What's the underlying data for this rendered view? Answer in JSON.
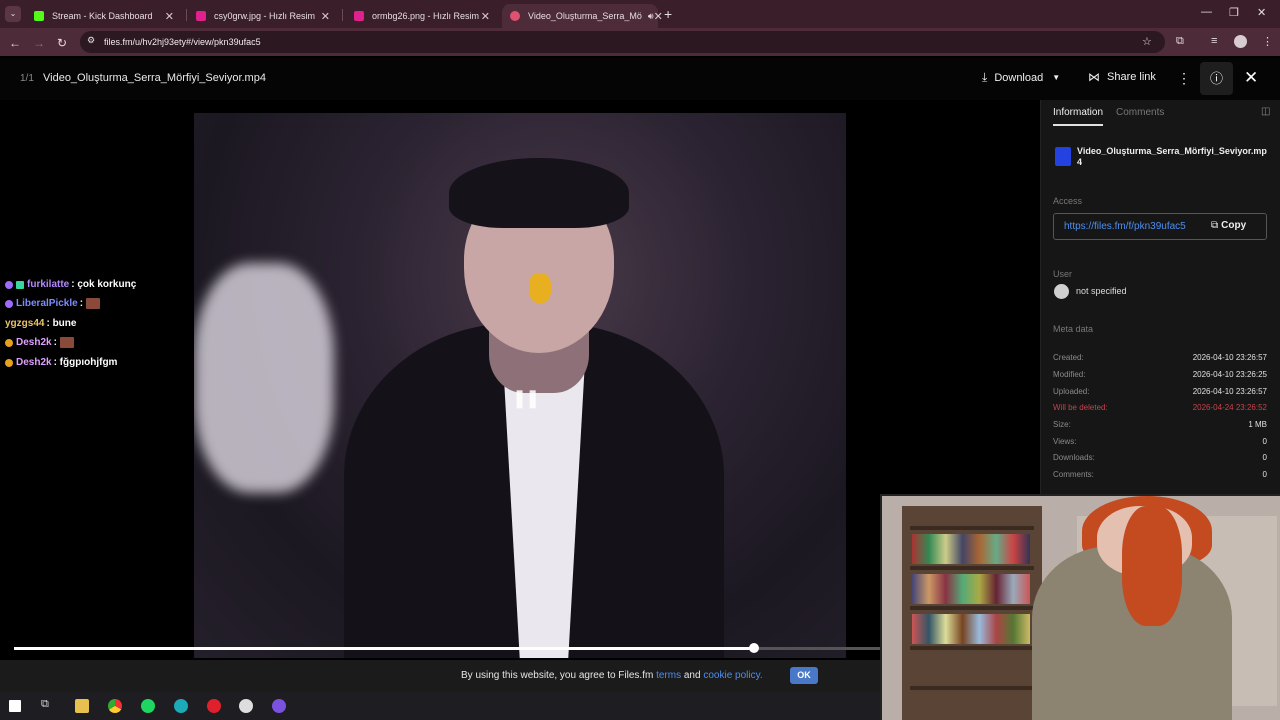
{
  "browser": {
    "tabs": [
      {
        "title": "Stream - Kick Dashboard",
        "favicon_color": "#53fc18"
      },
      {
        "title": "csy0grw.jpg - Hızlı Resim",
        "favicon_color": "#e0208c"
      },
      {
        "title": "ormbg26.png - Hızlı Resim",
        "favicon_color": "#e0208c"
      },
      {
        "title": "Video_Oluşturma_Serra_Mö",
        "favicon_color": "#e05070"
      }
    ],
    "url": "files.fm/u/hv2hj93ety#/view/pkn39ufac5"
  },
  "viewer": {
    "page_count": "1/1",
    "filename": "Video_Oluşturma_Serra_Mörfiyi_Seviyor.mp4",
    "download_label": "Download",
    "share_label": "Share link"
  },
  "chat": [
    {
      "user": "furkilatte",
      "user_color": "#b388ff",
      "message": ": çok korkunç",
      "emote": false
    },
    {
      "user": "LiberalPickle",
      "user_color": "#7c8cff",
      "message": ":",
      "emote": true
    },
    {
      "user": "ygzgs44",
      "user_color": "#e8c36a",
      "message": ": bune",
      "emote": false
    },
    {
      "user": "Desh2k",
      "user_color": "#e0a0ff",
      "message": ":",
      "emote": true
    },
    {
      "user": "Desh2k",
      "user_color": "#e0a0ff",
      "message": ": fğgpıohjfgm",
      "emote": false
    }
  ],
  "panel": {
    "tab_information": "Information",
    "tab_comments": "Comments",
    "filename": "Video_Oluşturma_Serra_Mörfiyi_Seviyor.mp4",
    "access_label": "Access",
    "access_link": "https://files.fm/f/pkn39ufac5",
    "copy_label": "Copy",
    "user_label": "User",
    "user_value": "not specified",
    "meta_label": "Meta data",
    "meta": [
      {
        "label": "Created:",
        "value": "2026-04-10 23:26:57"
      },
      {
        "label": "Modified:",
        "value": "2026-04-10 23:26:25"
      },
      {
        "label": "Uploaded:",
        "value": "2026-04-10 23:26:57"
      },
      {
        "label": "Will be deleted:",
        "value": "2026-04-24 23:26:52"
      },
      {
        "label": "Size:",
        "value": "1 MB"
      },
      {
        "label": "Views:",
        "value": "0"
      },
      {
        "label": "Downloads:",
        "value": "0"
      },
      {
        "label": "Comments:",
        "value": "0"
      }
    ]
  },
  "player": {
    "progress": 0.855
  },
  "cookie": {
    "text_before": "By using this website, you agree to Files.fm ",
    "terms": "terms",
    "and": " and ",
    "policy": "cookie policy.",
    "ok": "OK"
  },
  "colors": {
    "accent_blue": "#4d8ef0",
    "warning_red": "#c4444c",
    "browser_frame": "#3a1f2a"
  }
}
